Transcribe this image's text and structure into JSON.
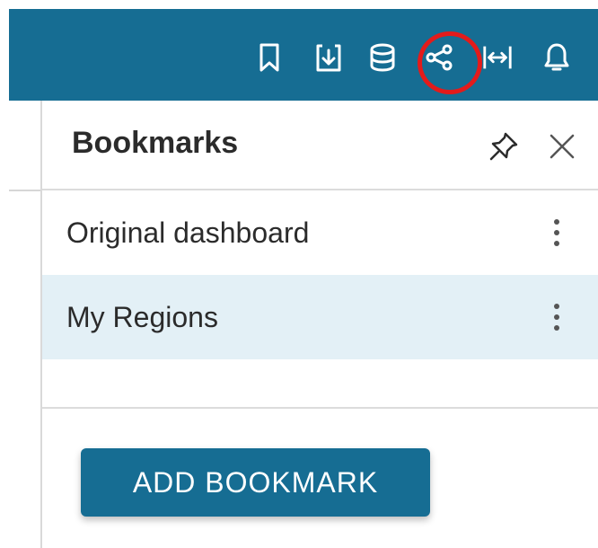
{
  "toolbar": {
    "icons": [
      {
        "name": "bookmark-icon",
        "label": "Bookmark"
      },
      {
        "name": "download-icon",
        "label": "Download"
      },
      {
        "name": "database-icon",
        "label": "Dataset"
      },
      {
        "name": "share-icon",
        "label": "Share"
      },
      {
        "name": "expand-width-icon",
        "label": "Fit to width"
      },
      {
        "name": "bell-icon",
        "label": "Alerts"
      }
    ],
    "background_color": "#166d93",
    "highlighted": "share-icon",
    "highlight_color": "#e31b1b"
  },
  "bookmarks_panel": {
    "title": "Bookmarks",
    "pin_icon": "pin-icon",
    "close_icon": "close-icon",
    "items": [
      {
        "label": "Original dashboard",
        "selected": false
      },
      {
        "label": "My Regions",
        "selected": true
      }
    ],
    "selected_color": "#e3f0f6",
    "add_button_label": "ADD BOOKMARK"
  }
}
